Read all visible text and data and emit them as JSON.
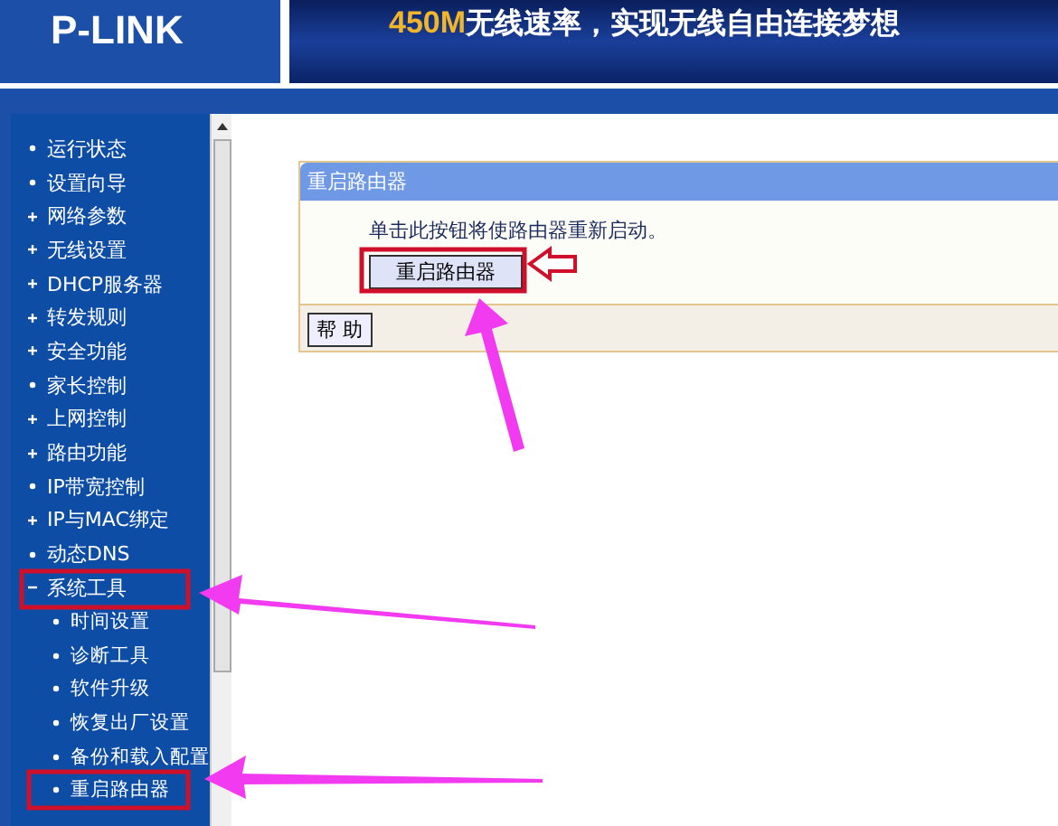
{
  "header": {
    "logo": "P-LINK",
    "slogan_highlight": "450M",
    "slogan": "无线速率，实现无线自由连接梦想"
  },
  "sidebar": {
    "items": [
      {
        "label": "运行状态",
        "kind": "link"
      },
      {
        "label": "设置向导",
        "kind": "link"
      },
      {
        "label": "网络参数",
        "kind": "group",
        "expanded": false
      },
      {
        "label": "无线设置",
        "kind": "group",
        "expanded": false
      },
      {
        "label": "DHCP服务器",
        "kind": "group",
        "expanded": false
      },
      {
        "label": "转发规则",
        "kind": "group",
        "expanded": false
      },
      {
        "label": "安全功能",
        "kind": "group",
        "expanded": false
      },
      {
        "label": "家长控制",
        "kind": "link"
      },
      {
        "label": "上网控制",
        "kind": "group",
        "expanded": false
      },
      {
        "label": "路由功能",
        "kind": "group",
        "expanded": false
      },
      {
        "label": "IP带宽控制",
        "kind": "link"
      },
      {
        "label": "IP与MAC绑定",
        "kind": "group",
        "expanded": false
      },
      {
        "label": "动态DNS",
        "kind": "link"
      },
      {
        "label": "系统工具",
        "kind": "group",
        "expanded": true,
        "children": [
          {
            "label": "时间设置",
            "kind": "link"
          },
          {
            "label": "诊断工具",
            "kind": "link"
          },
          {
            "label": "软件升级",
            "kind": "link"
          },
          {
            "label": "恢复出厂设置",
            "kind": "link"
          },
          {
            "label": "备份和载入配置",
            "kind": "link"
          },
          {
            "label": "重启路由器",
            "kind": "link"
          }
        ]
      }
    ]
  },
  "panel": {
    "title": "重启路由器",
    "message": "单击此按钮将使路由器重新启动。",
    "button": "重启路由器",
    "help_button": "帮 助"
  }
}
